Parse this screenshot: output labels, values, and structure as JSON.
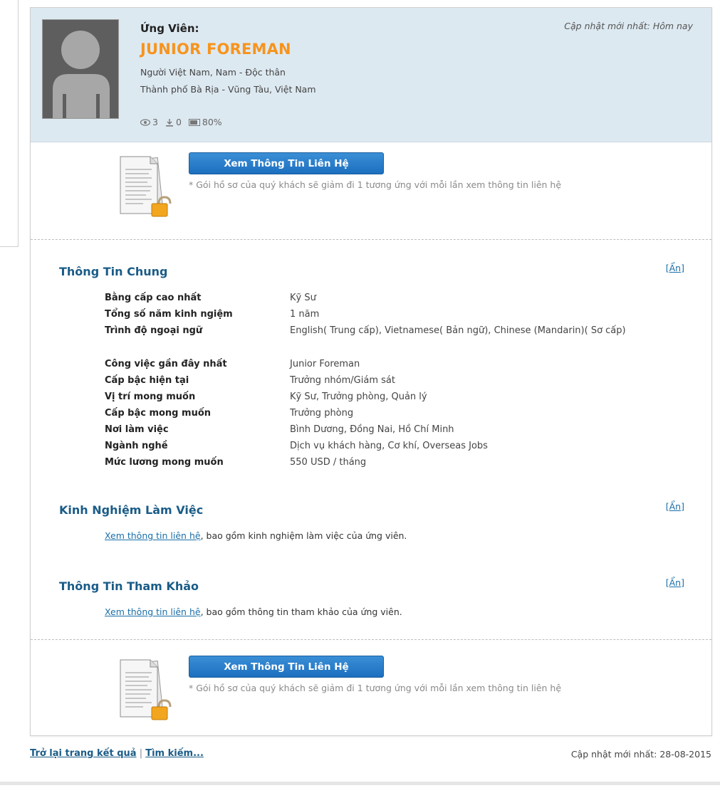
{
  "candidate": {
    "label": "Ứng Viên:",
    "name": "JUNIOR FOREMAN",
    "nationality_line": "Người Việt Nam, Nam - Độc thân",
    "location_line": "Thành phố Bà Rịa - Vũng Tàu, Việt Nam",
    "updated_top": "Cập nhật mới nhất: Hôm nay",
    "stats": {
      "views": "3",
      "downloads": "0",
      "completion": "80%"
    }
  },
  "contact": {
    "button_label": "Xem Thông Tin Liên Hệ",
    "note": "* Gói hồ sơ của quý khách sẽ giảm đi 1 tương ứng với mỗi lần xem thông tin liên hệ"
  },
  "sections": {
    "general": {
      "title": "Thông Tin Chung",
      "hide_label": "Ẩn",
      "rows": [
        {
          "key": "Bằng cấp cao nhất",
          "value": "Kỹ Sư"
        },
        {
          "key": "Tổng số năm kinh ngiệm",
          "value": "1 năm"
        },
        {
          "key": "Trình độ ngoại ngữ",
          "value": "English( Trung cấp), Vietnamese( Bản ngữ), Chinese (Mandarin)( Sơ cấp)"
        },
        {
          "key": "Công việc gần đây nhất",
          "value": "Junior Foreman"
        },
        {
          "key": "Cấp bậc hiện tại",
          "value": "Trưởng nhóm/Giám sát"
        },
        {
          "key": "Vị trí mong muốn",
          "value": "Kỹ Sư, Trưởng phòng, Quản lý"
        },
        {
          "key": "Cấp bậc mong muốn",
          "value": "Trưởng phòng"
        },
        {
          "key": "Nơi làm việc",
          "value": "Bình Dương, Đồng Nai, Hồ Chí Minh"
        },
        {
          "key": "Ngành nghề",
          "value": "Dịch vụ khách hàng, Cơ khí, Overseas Jobs"
        },
        {
          "key": "Mức lương mong muốn",
          "value": "550 USD / tháng"
        }
      ]
    },
    "experience": {
      "title": "Kinh Nghiệm Làm Việc",
      "hide_label": "Ẩn",
      "link_text": "Xem thông tin liên hệ",
      "rest_text": ", bao gồm kinh nghiệm làm việc của ứng viên."
    },
    "reference": {
      "title": "Thông Tin Tham Khảo",
      "hide_label": "Ẩn",
      "link_text": "Xem thông tin liên hệ",
      "rest_text": ", bao gồm thông tin tham khảo của ứng viên."
    }
  },
  "footer": {
    "back_link": "Trở lại trang kết quả",
    "separator": "|",
    "search_link": "Tìm kiếm...",
    "updated": "Cập nhật mới nhất: 28-08-2015"
  },
  "colors": {
    "header_bg": "#dde9f1",
    "name_orange": "#f7941d",
    "section_title_blue": "#1a5c87",
    "button_blue": "#1c6fbf"
  }
}
